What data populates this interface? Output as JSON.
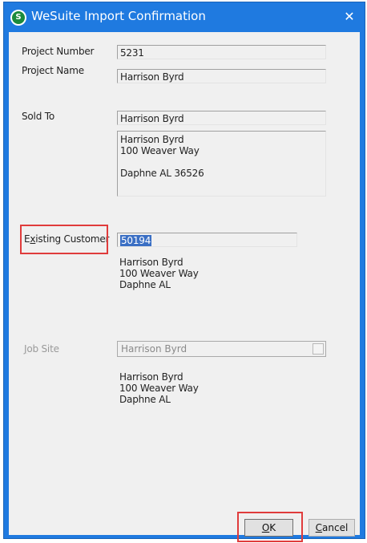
{
  "window": {
    "title": "WeSuite Import Confirmation",
    "app_icon_letter": "S",
    "close_glyph": "✕"
  },
  "fields": {
    "project_number": {
      "label": "Project Number",
      "value": "5231"
    },
    "project_name": {
      "label": "Project Name",
      "value": "Harrison Byrd"
    },
    "sold_to": {
      "label": "Sold To",
      "name_value": "Harrison Byrd",
      "address_lines": [
        "Harrison Byrd",
        "100 Weaver Way",
        "",
        "Daphne AL 36526"
      ]
    },
    "existing_customer": {
      "label_prefix": "E",
      "label_mnemonic": "x",
      "label_rest": "isting Customer",
      "value": "50194",
      "address_lines": [
        "Harrison Byrd",
        "100 Weaver Way",
        "Daphne AL"
      ]
    },
    "job_site": {
      "label_mnemonic": "J",
      "label_rest": "ob Site",
      "value": "Harrison Byrd",
      "address_lines": [
        "Harrison Byrd",
        "100 Weaver Way",
        "Daphne AL"
      ]
    }
  },
  "buttons": {
    "ok": {
      "mnemonic": "O",
      "rest": "K"
    },
    "cancel": {
      "mnemonic": "C",
      "rest": "ancel"
    }
  },
  "colors": {
    "titlebar": "#1f7ae0",
    "highlight": "#e03c3c",
    "selection": "#3a6fc4"
  },
  "icons": {
    "app": "wesuite-app-icon",
    "close": "close-icon",
    "dropdown": "dropdown-button-icon"
  }
}
